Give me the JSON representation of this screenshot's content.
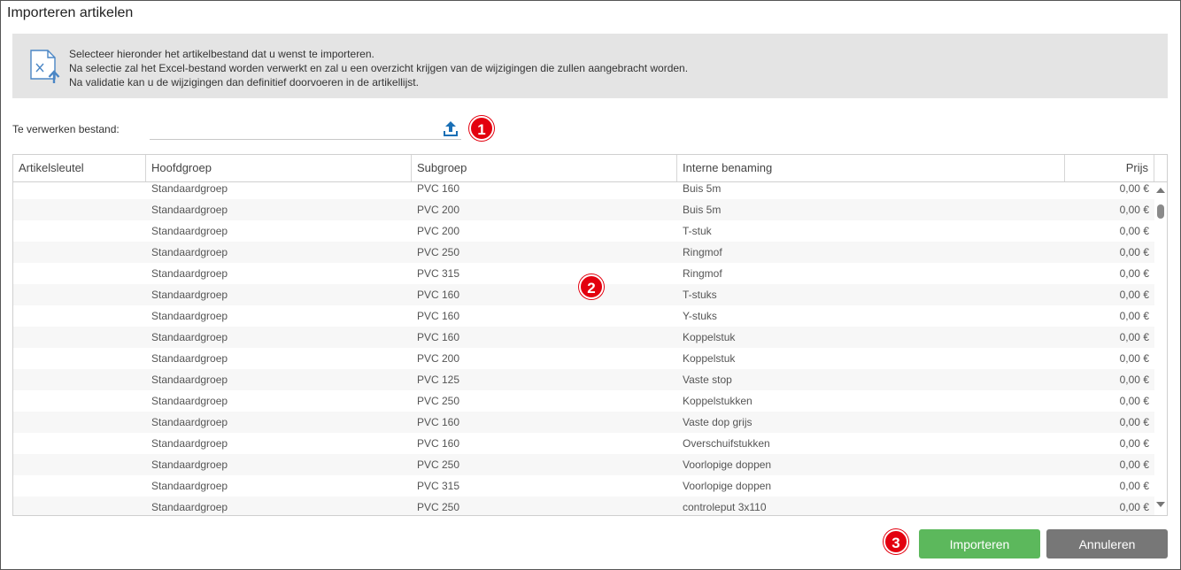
{
  "dialog": {
    "title": "Importeren artikelen"
  },
  "info": {
    "lines": [
      "Selecteer hieronder het artikelbestand dat u wenst te importeren.",
      "Na selectie zal het Excel-bestand worden verwerkt en zal u een overzicht krijgen van de wijzigingen die zullen aangebracht worden.",
      "Na validatie kan u de wijzigingen dan definitief doorvoeren in de artikellijst."
    ]
  },
  "file": {
    "label": "Te verwerken bestand:",
    "value": "",
    "placeholder": ""
  },
  "badges": [
    "1",
    "2",
    "3"
  ],
  "grid": {
    "columns": [
      "Artikelsleutel",
      "Hoofdgroep",
      "Subgroep",
      "Interne benaming",
      "Prijs"
    ],
    "rows": [
      [
        "",
        "Standaardgroep",
        "PVC 160",
        "Buis 5m",
        "0,00 €"
      ],
      [
        "",
        "Standaardgroep",
        "PVC 200",
        "Buis 5m",
        "0,00 €"
      ],
      [
        "",
        "Standaardgroep",
        "PVC 200",
        "T-stuk",
        "0,00 €"
      ],
      [
        "",
        "Standaardgroep",
        "PVC 250",
        "Ringmof",
        "0,00 €"
      ],
      [
        "",
        "Standaardgroep",
        "PVC 315",
        "Ringmof",
        "0,00 €"
      ],
      [
        "",
        "Standaardgroep",
        "PVC 160",
        "T-stuks",
        "0,00 €"
      ],
      [
        "",
        "Standaardgroep",
        "PVC 160",
        "Y-stuks",
        "0,00 €"
      ],
      [
        "",
        "Standaardgroep",
        "PVC 160",
        "Koppelstuk",
        "0,00 €"
      ],
      [
        "",
        "Standaardgroep",
        "PVC 200",
        "Koppelstuk",
        "0,00 €"
      ],
      [
        "",
        "Standaardgroep",
        "PVC 125",
        "Vaste stop",
        "0,00 €"
      ],
      [
        "",
        "Standaardgroep",
        "PVC 250",
        "Koppelstukken",
        "0,00 €"
      ],
      [
        "",
        "Standaardgroep",
        "PVC 160",
        "Vaste dop grijs",
        "0,00 €"
      ],
      [
        "",
        "Standaardgroep",
        "PVC 160",
        "Overschuifstukken",
        "0,00 €"
      ],
      [
        "",
        "Standaardgroep",
        "PVC 250",
        "Voorlopige doppen",
        "0,00 €"
      ],
      [
        "",
        "Standaardgroep",
        "PVC 315",
        "Voorlopige doppen",
        "0,00 €"
      ],
      [
        "",
        "Standaardgroep",
        "PVC 250",
        "controleput 3x110",
        "0,00 €"
      ]
    ]
  },
  "actions": {
    "import_label": "Importeren",
    "cancel_label": "Annuleren"
  },
  "colors": {
    "import": "#5cb85c",
    "cancel": "#777777",
    "badge": "#e3000f",
    "upload_icon": "#1a6fb5",
    "info_bg": "#e4e4e4"
  },
  "icons": {
    "info": "excel-file-upload-icon",
    "upload": "upload-icon"
  }
}
